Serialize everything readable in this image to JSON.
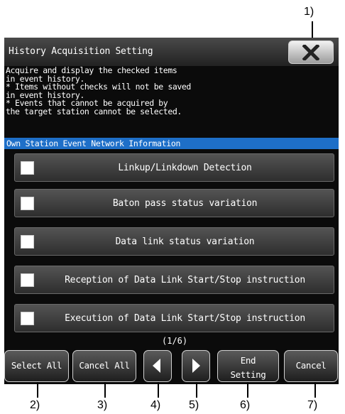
{
  "window": {
    "title": "History Acquisition Setting"
  },
  "description": "Acquire and display the checked items\nin event history.\n* Items without checks will not be saved\nin event history.\n* Events that cannot be acquired by\nthe target station cannot be selected.",
  "section": "Own Station Event Network Information",
  "items": [
    {
      "label": "Linkup/Linkdown Detection",
      "checked": false
    },
    {
      "label": "Baton pass status variation",
      "checked": false
    },
    {
      "label": "Data link status variation",
      "checked": false
    },
    {
      "label": "Reception of Data Link Start/Stop instruction",
      "checked": false
    },
    {
      "label": "Execution of Data Link Start/Stop instruction",
      "checked": false
    }
  ],
  "pager": "(1/6)",
  "buttons": {
    "select_all": "Select All",
    "cancel_all": "Cancel All",
    "end_setting_line1": "End",
    "end_setting_line2": "Setting",
    "cancel": "Cancel"
  },
  "callouts": [
    "1)",
    "2)",
    "3)",
    "4)",
    "5)",
    "6)",
    "7)"
  ],
  "icons": {
    "close": "close-x-icon",
    "prev": "triangle-left-icon",
    "next": "triangle-right-icon"
  }
}
